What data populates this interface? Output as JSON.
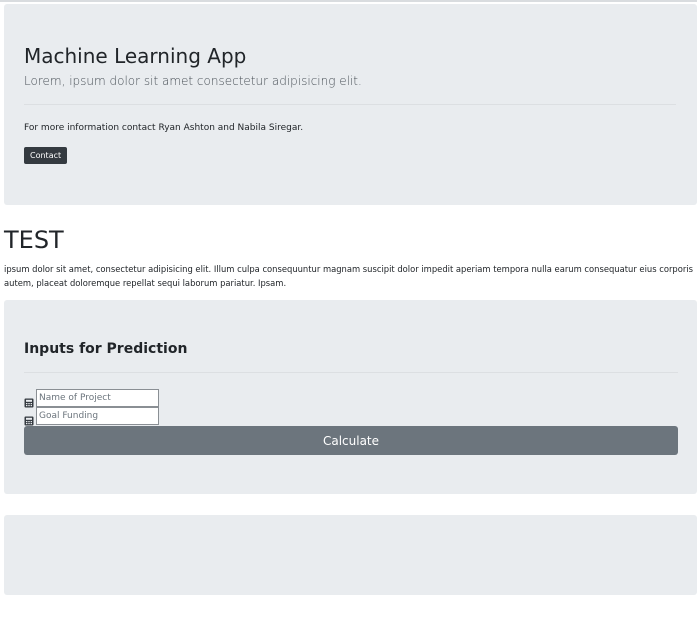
{
  "header": {
    "title": "Machine Learning App",
    "lead": "Lorem, ipsum dolor sit amet consectetur adipisicing elit.",
    "contact_text": "For more information contact Ryan Ashton and Nabila Siregar.",
    "contact_button": "Contact"
  },
  "test_section": {
    "heading": "TEST",
    "paragraph": "ipsum dolor sit amet, consectetur adipisicing elit. Illum culpa consequuntur magnam suscipit dolor impedit aperiam tempora nulla earum consequatur eius corporis autem, placeat doloremque repellat sequi laborum pariatur. Ipsam."
  },
  "prediction": {
    "title": "Inputs for Prediction",
    "fields": [
      {
        "icon": "calculator-icon",
        "placeholder": "Name of Project",
        "value": ""
      },
      {
        "icon": "calculator-icon",
        "placeholder": "Goal Funding",
        "value": ""
      }
    ],
    "calculate_button": "Calculate"
  },
  "colors": {
    "panel_bg": "#e9ecef",
    "dark_button": "#343a40",
    "secondary_button": "#6c757d"
  }
}
